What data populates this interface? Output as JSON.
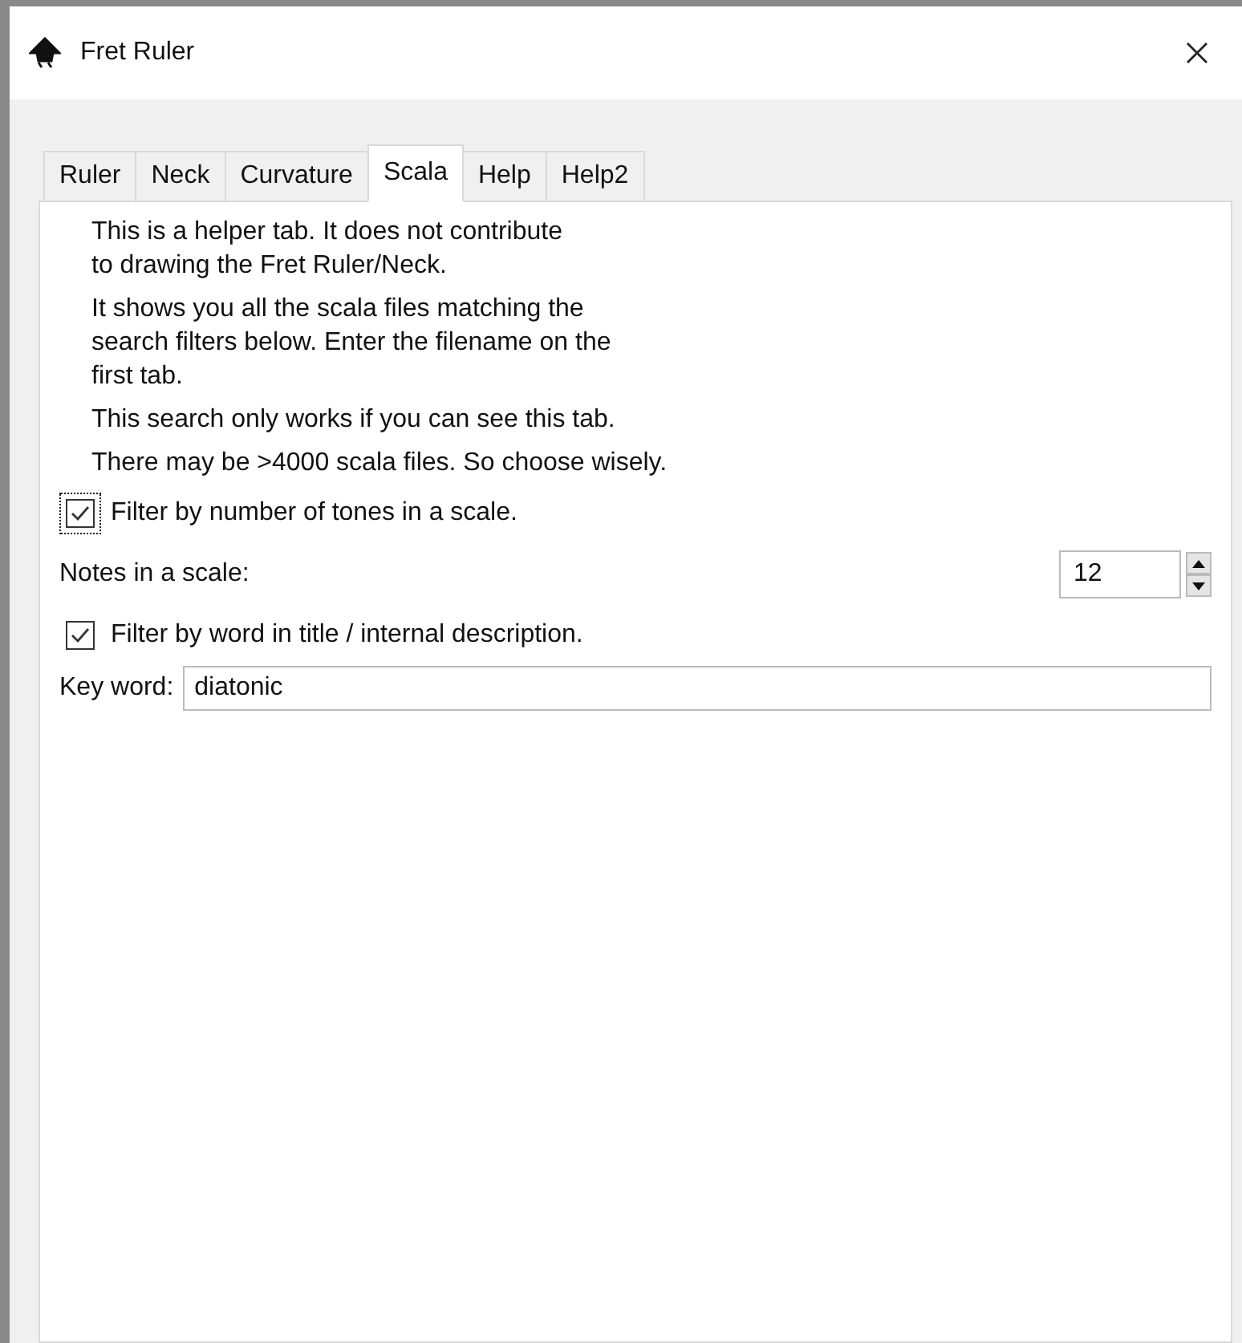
{
  "window": {
    "title": "Fret Ruler"
  },
  "tabs": [
    {
      "label": "Ruler",
      "selected": false
    },
    {
      "label": "Neck",
      "selected": false
    },
    {
      "label": "Curvature",
      "selected": false
    },
    {
      "label": "Scala",
      "selected": true
    },
    {
      "label": "Help",
      "selected": false
    },
    {
      "label": "Help2",
      "selected": false
    }
  ],
  "info": [
    "This is a helper tab. It does not contribute\nto drawing the Fret Ruler/Neck.",
    "It shows you all the scala files matching the\nsearch filters below. Enter the filename on the\nfirst tab.",
    "This search only works if you can see this tab.",
    "There may be >4000 scala files. So choose wisely."
  ],
  "filter_tones": {
    "label": "Filter by number of tones in a scale.",
    "checked": true,
    "focused": true
  },
  "notes": {
    "label": "Notes in a scale:",
    "value": "12"
  },
  "filter_word": {
    "label": "Filter by word in title / internal description.",
    "checked": true,
    "focused": false
  },
  "key_word": {
    "label": "Key word:",
    "value": "diatonic"
  }
}
